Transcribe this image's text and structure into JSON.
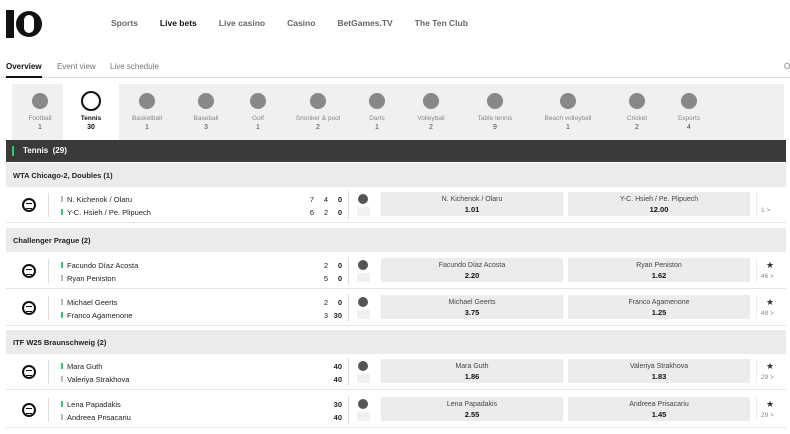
{
  "nav": {
    "items": [
      {
        "label": "Sports",
        "active": false
      },
      {
        "label": "Live bets",
        "active": true
      },
      {
        "label": "Live casino",
        "active": false
      },
      {
        "label": "Casino",
        "active": false
      },
      {
        "label": "BetGames.TV",
        "active": false
      },
      {
        "label": "The Ten Club",
        "active": false
      }
    ]
  },
  "subnav": {
    "overview": "Overview",
    "event_view": "Event view",
    "live_schedule": "Live schedule",
    "right": "O"
  },
  "sports": [
    {
      "name": "Football",
      "count": "1",
      "icon": "football-icon"
    },
    {
      "name": "Tennis",
      "count": "30",
      "icon": "tennis-icon",
      "active": true
    },
    {
      "name": "Basketball",
      "count": "1",
      "icon": "basketball-icon"
    },
    {
      "name": "Baseball",
      "count": "3",
      "icon": "baseball-icon"
    },
    {
      "name": "Golf",
      "count": "1",
      "icon": "golf-icon"
    },
    {
      "name": "Snooker & pool",
      "count": "2",
      "icon": "snooker-icon"
    },
    {
      "name": "Darts",
      "count": "1",
      "icon": "darts-icon"
    },
    {
      "name": "Volleyball",
      "count": "2",
      "icon": "volleyball-icon"
    },
    {
      "name": "Table tennis",
      "count": "9",
      "icon": "table-tennis-icon"
    },
    {
      "name": "Beach volleyball",
      "count": "1",
      "icon": "beach-volleyball-icon"
    },
    {
      "name": "Cricket",
      "count": "2",
      "icon": "cricket-icon"
    },
    {
      "name": "Esports",
      "count": "4",
      "icon": "esports-icon"
    }
  ],
  "section": {
    "title": "Tennis",
    "count": "(29)"
  },
  "leagues": [
    {
      "title": "WTA Chicago-2, Doubles (1)"
    },
    {
      "title": "Challenger Prague (2)"
    },
    {
      "title": "ITF W25 Braunschweig (2)"
    }
  ],
  "matches": [
    {
      "p1": "N. Kichenok / Olaru",
      "p2": "Y-C. Hsieh / Pe. Plipuech",
      "s1": [
        "7",
        "4",
        "0"
      ],
      "s2": [
        "6",
        "2",
        "0"
      ],
      "srv": 2,
      "o1_name": "N. Kichenok / Olaru",
      "o1_val": "1.01",
      "o2_name": "Y-C. Hsieh / Pe. Plipuech",
      "o2_val": "12.00",
      "more": "1 >",
      "star": false
    },
    {
      "p1": "Facundo Díaz Acosta",
      "p2": "Ryan Peniston",
      "s1": [
        "",
        "2",
        "0"
      ],
      "s2": [
        "",
        "5",
        "0"
      ],
      "srv": 1,
      "o1_name": "Facundo Díaz Acosta",
      "o1_val": "2.20",
      "o2_name": "Ryan Peniston",
      "o2_val": "1.62",
      "more": "46 >",
      "star": true
    },
    {
      "p1": "Michael Geerts",
      "p2": "Franco Agamenone",
      "s1": [
        "",
        "2",
        "0"
      ],
      "s2": [
        "",
        "3",
        "30"
      ],
      "srv": 2,
      "o1_name": "Michael Geerts",
      "o1_val": "3.75",
      "o2_name": "Franco Agamenone",
      "o2_val": "1.25",
      "more": "48 >",
      "star": true
    },
    {
      "p1": "Mara Guth",
      "p2": "Valeriya Strakhova",
      "s1": [
        "",
        "",
        "40"
      ],
      "s2": [
        "",
        "",
        "40"
      ],
      "srv": 1,
      "o1_name": "Mara Guth",
      "o1_val": "1.86",
      "o2_name": "Valeriya Strakhova",
      "o2_val": "1.83",
      "more": "29 >",
      "star": true
    },
    {
      "p1": "Lena Papadakis",
      "p2": "Andreea Prisacariu",
      "s1": [
        "",
        "",
        "30"
      ],
      "s2": [
        "",
        "",
        "40"
      ],
      "srv": 1,
      "o1_name": "Lena Papadakis",
      "o1_val": "2.55",
      "o2_name": "Andreea Prisacariu",
      "o2_val": "1.45",
      "more": "29 >",
      "star": true
    }
  ],
  "star_glyph": "★",
  "colors": {
    "accent": "#2ecc71",
    "header_dark": "#3a3a3a"
  }
}
